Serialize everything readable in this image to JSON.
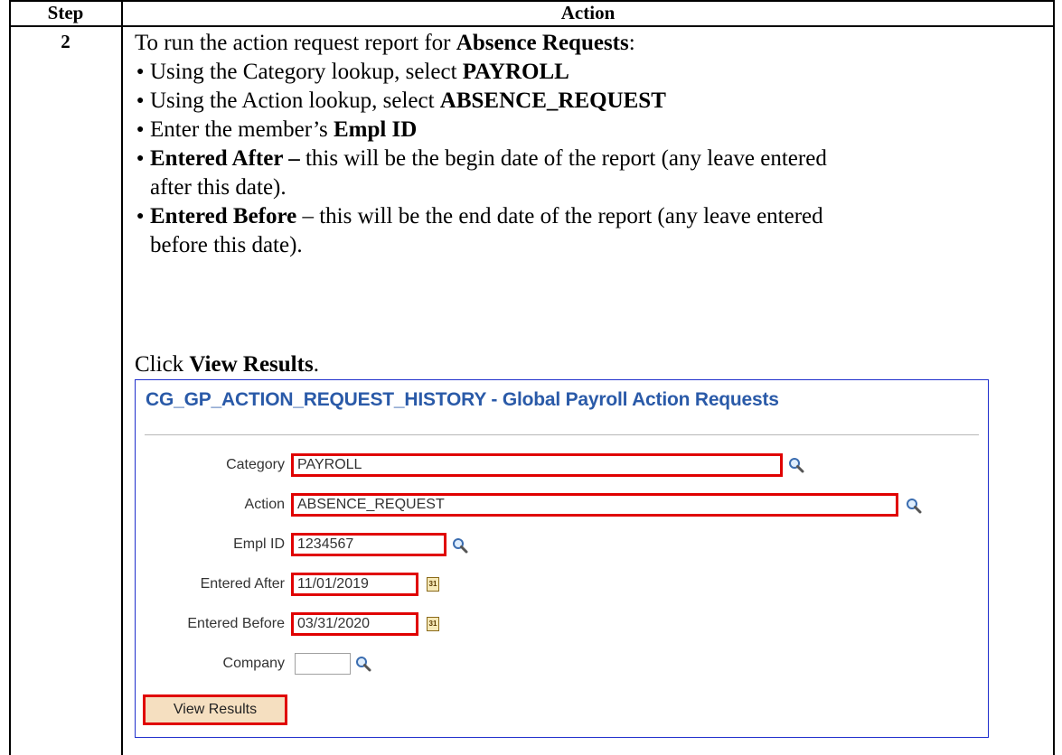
{
  "table": {
    "header_step": "Step",
    "header_action": "Action",
    "step_number": "2"
  },
  "instructions": {
    "intro_prefix": "To run the action request report for ",
    "intro_bold": "Absence Requests",
    "intro_suffix": ":",
    "bullets": [
      {
        "prefix": "Using the Category lookup, select ",
        "bold": "PAYROLL"
      },
      {
        "prefix": "Using the Action lookup, select ",
        "bold": "ABSENCE_REQUEST"
      },
      {
        "prefix": "Enter the member’s ",
        "bold": "Empl ID"
      },
      {
        "bold": "Entered After –",
        "suffix": " this will be the begin date of the report (any leave entered",
        "line2": "after this date)."
      },
      {
        "bold": "Entered Before",
        "suffix": " – this will be the end date of the report (any leave entered",
        "line2": "before this date)."
      }
    ],
    "click_prefix": "Click ",
    "click_bold": "View Results",
    "click_suffix": "."
  },
  "screenshot": {
    "title": "CG_GP_ACTION_REQUEST_HISTORY - Global Payroll Action Requests",
    "fields": {
      "category": {
        "label": "Category",
        "value": "PAYROLL"
      },
      "action": {
        "label": "Action",
        "value": "ABSENCE_REQUEST"
      },
      "empl_id": {
        "label": "Empl ID",
        "value": "1234567"
      },
      "entered_after": {
        "label": "Entered After",
        "value": "11/01/2019"
      },
      "entered_before": {
        "label": "Entered Before",
        "value": "03/31/2020"
      },
      "company": {
        "label": "Company",
        "value": ""
      }
    },
    "calendar_glyph": "31",
    "button_label": "View Results",
    "colors": {
      "highlight": "#e00000",
      "title": "#2a5aa8",
      "panel_border": "#1f2fcc",
      "button_bg": "#f5dfc0"
    }
  }
}
